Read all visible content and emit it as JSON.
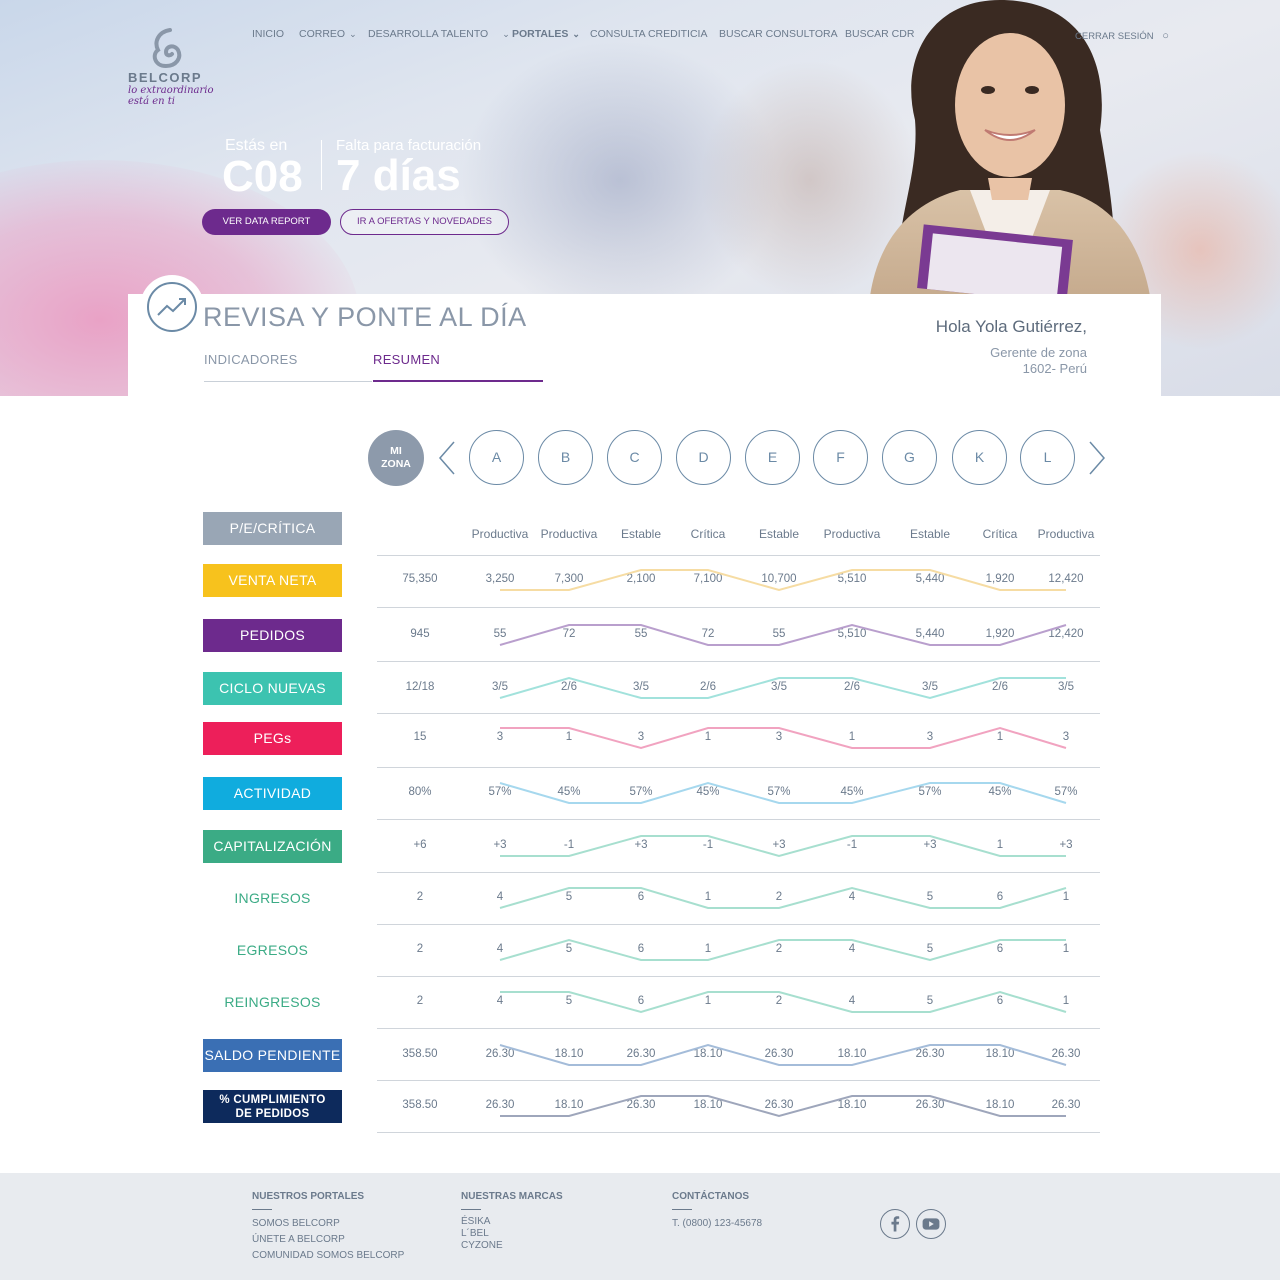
{
  "brand": {
    "name": "BELCORP",
    "tagline_line1": "lo extraordinario",
    "tagline_line2": "está en ti"
  },
  "nav": {
    "items": [
      {
        "label": "INICIO"
      },
      {
        "label": "CORREO"
      },
      {
        "label": "DESARROLLA TALENTO"
      },
      {
        "label": "PORTALES"
      },
      {
        "label": "CONSULTA CREDITICIA"
      },
      {
        "label": "BUSCAR CONSULTORA"
      },
      {
        "label": "BUSCAR CDR"
      }
    ],
    "logout": "CERRAR SESIÓN"
  },
  "hero": {
    "campaign_label": "Estás en",
    "campaign_value": "C08",
    "days_label": "Falta para facturación",
    "days_value": "7 días",
    "btn_data_report": "VER DATA REPORT",
    "btn_ofertas": "IR A OFERTAS Y NOVEDADES"
  },
  "panel": {
    "title": "REVISA Y PONTE AL DÍA",
    "tab_indicadores": "INDICADORES",
    "tab_resumen": "RESUMEN",
    "greeting": "Hola Yola Gutiérrez,",
    "role": "Gerente de zona",
    "location": "1602- Perú"
  },
  "zones": {
    "mine_line1": "MI",
    "mine_line2": "ZONA",
    "list": [
      "A",
      "B",
      "C",
      "D",
      "E",
      "F",
      "G",
      "K",
      "L"
    ]
  },
  "table": {
    "header_label": "P/E/CRÍTICA",
    "headers": [
      "Productiva",
      "Productiva",
      "Estable",
      "Crítica",
      "Estable",
      "Productiva",
      "Estable",
      "Crítica",
      "Productiva"
    ],
    "rows": [
      {
        "label": "VENTA NETA",
        "color": "#f7c21d",
        "line": "#f6dca3",
        "total": "75,350",
        "values": [
          "3,250",
          "7,300",
          "2,100",
          "7,100",
          "10,700",
          "5,510",
          "5,440",
          "1,920",
          "12,420"
        ]
      },
      {
        "label": "PEDIDOS",
        "color": "#6d2a8d",
        "line": "#b99fcd",
        "total": "945",
        "values": [
          "55",
          "72",
          "55",
          "72",
          "55",
          "5,510",
          "5,440",
          "1,920",
          "12,420"
        ]
      },
      {
        "label": "CICLO NUEVAS",
        "color": "#3cc3b0",
        "line": "#a2e2dc",
        "total": "12/18",
        "values": [
          "3/5",
          "2/6",
          "3/5",
          "2/6",
          "3/5",
          "2/6",
          "3/5",
          "2/6",
          "3/5"
        ]
      },
      {
        "label": "PEGs",
        "color": "#ed1f5a",
        "line": "#f1a3c0",
        "total": "15",
        "values": [
          "3",
          "1",
          "3",
          "1",
          "3",
          "1",
          "3",
          "1",
          "3"
        ]
      },
      {
        "label": "ACTIVIDAD",
        "color": "#10acde",
        "line": "#a6d8ee",
        "total": "80%",
        "values": [
          "57%",
          "45%",
          "57%",
          "45%",
          "57%",
          "45%",
          "57%",
          "45%",
          "57%"
        ]
      },
      {
        "label": "CAPITALIZACIÓN",
        "color": "#3bab85",
        "line": "#a7dfcf",
        "total": "+6",
        "values": [
          "+3",
          "-1",
          "+3",
          "-1",
          "+3",
          "-1",
          "+3",
          "1",
          "+3"
        ]
      },
      {
        "label": "INGRESOS",
        "color": "#3bab85",
        "line": "#a7dfcf",
        "total": "2",
        "values": [
          "4",
          "5",
          "6",
          "1",
          "2",
          "4",
          "5",
          "6",
          "1"
        ]
      },
      {
        "label": "EGRESOS",
        "color": "#3bab85",
        "line": "#a7dfcf",
        "total": "2",
        "values": [
          "4",
          "5",
          "6",
          "1",
          "2",
          "4",
          "5",
          "6",
          "1"
        ]
      },
      {
        "label": "REINGRESOS",
        "color": "#3bab85",
        "line": "#a7dfcf",
        "total": "2",
        "values": [
          "4",
          "5",
          "6",
          "1",
          "2",
          "4",
          "5",
          "6",
          "1"
        ]
      },
      {
        "label": "SALDO PENDIENTE",
        "color": "#3a6fb4",
        "line": "#a4bcd9",
        "total": "358.50",
        "values": [
          "26.30",
          "18.10",
          "26.30",
          "18.10",
          "26.30",
          "18.10",
          "26.30",
          "18.10",
          "26.30"
        ]
      },
      {
        "label": "% CUMPLIMIENTO DE PEDIDOS",
        "label_line1": "% CUMPLIMIENTO",
        "label_line2": "DE PEDIDOS",
        "color": "#0d2a5c",
        "line": "#9ea6bb",
        "total": "358.50",
        "values": [
          "26.30",
          "18.10",
          "26.30",
          "18.10",
          "26.30",
          "18.10",
          "26.30",
          "18.10",
          "26.30"
        ]
      }
    ]
  },
  "footer": {
    "portales_title": "NUESTROS PORTALES",
    "portales": [
      "SOMOS BELCORP",
      "ÚNETE A BELCORP",
      "COMUNIDAD SOMOS BELCORP"
    ],
    "marcas_title": "NUESTRAS MARCAS",
    "marcas": [
      "ÉSIKA",
      "L´BEL",
      "CYZONE"
    ],
    "contacto_title": "CONTÁCTANOS",
    "telefono": "T. (0800) 123-45678"
  }
}
